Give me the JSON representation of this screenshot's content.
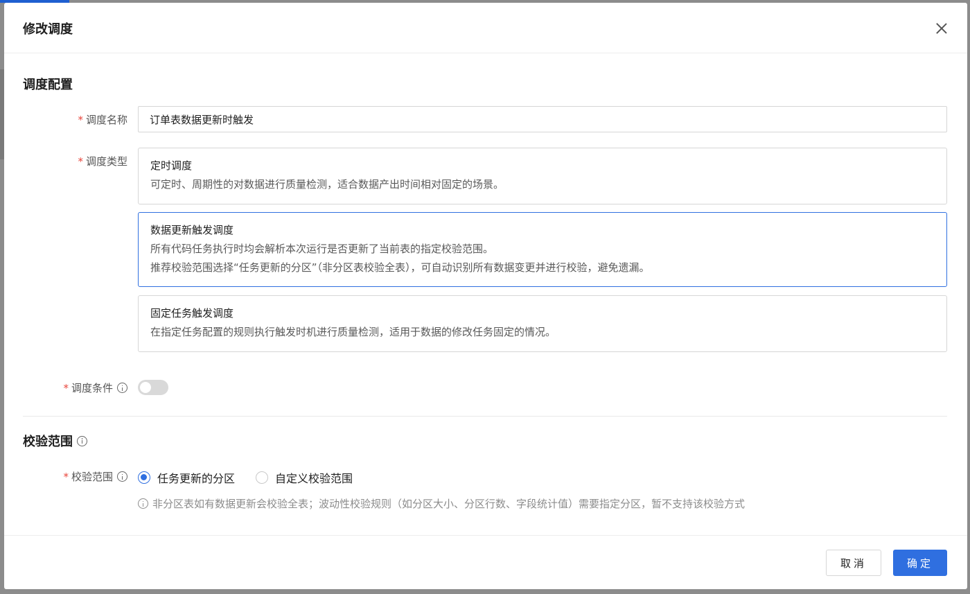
{
  "dialog": {
    "title": "修改调度",
    "close_icon": "close-icon"
  },
  "schedule_section": {
    "title": "调度配置",
    "name": {
      "label": "调度名称",
      "required_mark": "*",
      "value": "订单表数据更新时触发"
    },
    "type": {
      "label": "调度类型",
      "required_mark": "*",
      "selected": "数据更新触发调度",
      "options": [
        {
          "title": "定时调度",
          "desc": [
            "可定时、周期性的对数据进行质量检测，适合数据产出时间相对固定的场景。"
          ]
        },
        {
          "title": "数据更新触发调度",
          "desc": [
            "所有代码任务执行时均会解析本次运行是否更新了当前表的指定校验范围。",
            "推荐校验范围选择“任务更新的分区”（非分区表校验全表），可自动识别所有数据变更并进行校验，避免遗漏。"
          ]
        },
        {
          "title": "固定任务触发调度",
          "desc": [
            "在指定任务配置的规则执行触发时机进行质量检测，适用于数据的修改任务固定的情况。"
          ]
        }
      ]
    },
    "condition": {
      "label": "调度条件",
      "required_mark": "*",
      "enabled": false
    }
  },
  "scope_section": {
    "title": "校验范围",
    "scope": {
      "label": "校验范围",
      "required_mark": "*",
      "options": [
        "任务更新的分区",
        "自定义校验范围"
      ],
      "selected": "任务更新的分区"
    },
    "hint": "非分区表如有数据更新会校验全表；波动性校验规则（如分区大小、分区行数、字段统计值）需要指定分区，暂不支持该校验方式"
  },
  "footer": {
    "cancel_label": "取消",
    "ok_label": "确定"
  },
  "colors": {
    "primary": "#2f6fe0",
    "required": "#e8463c",
    "border": "#d6d6d6"
  }
}
